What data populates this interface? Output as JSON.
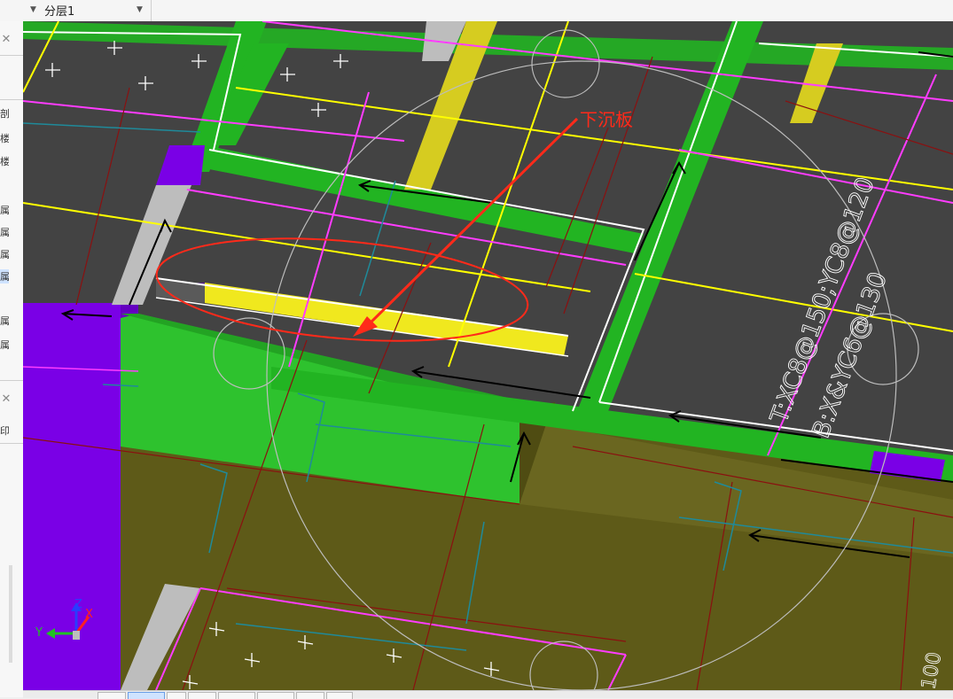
{
  "toolbar": {
    "layer_dropdown_value": "分层1"
  },
  "left_panel": {
    "glyphs_top": [
      "剖",
      "楼",
      "楼",
      "属",
      "属",
      "属",
      "属",
      "属",
      "属"
    ],
    "glyphs_mid": [
      "印"
    ]
  },
  "viewport": {
    "annotation_label": "下沉板",
    "rebar_top_label": "T:XC8@150;YC8@120",
    "rebar_bottom_label": "B:X&YC6@130",
    "dimension_label": "100",
    "axis_y": "Y",
    "axis_z": "Z",
    "axis_x": "X",
    "colors": {
      "background": "#434343",
      "beam_green": "#22b422",
      "column_purple": "#7a00e6",
      "wall_olive": "#5e5a18",
      "rebar_yellow": "#ffff00",
      "rebar_magenta": "#ff3cff",
      "annotation_red": "#ff2a1a"
    }
  }
}
